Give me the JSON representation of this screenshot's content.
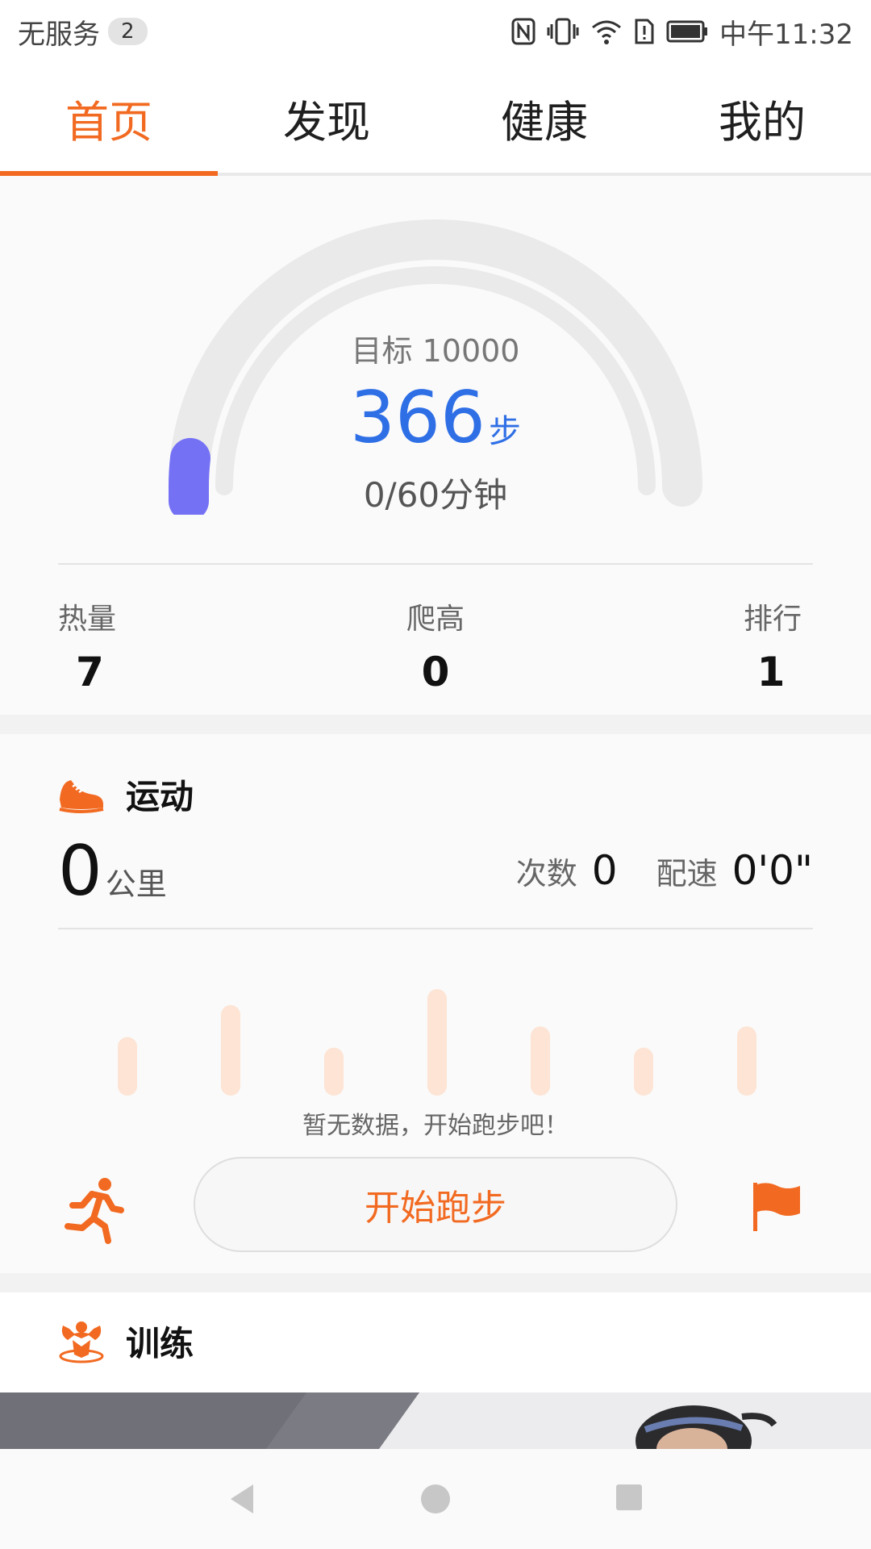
{
  "status_bar": {
    "carrier": "无服务",
    "sim_count": "2",
    "time": "中午11:32",
    "icons": [
      "nfc-icon",
      "vibrate-icon",
      "wifi-icon",
      "sim-alert-icon",
      "battery-icon"
    ]
  },
  "tabs": [
    {
      "label": "首页",
      "active": true
    },
    {
      "label": "发现",
      "active": false
    },
    {
      "label": "健康",
      "active": false
    },
    {
      "label": "我的",
      "active": false
    }
  ],
  "steps": {
    "goal_label": "目标 10000",
    "count": "366",
    "unit": "步",
    "minutes": "0/60分钟",
    "progress_fraction": 0.0366,
    "colors": {
      "progress": "#7571f5",
      "steps_text": "#2f6fe6",
      "track": "#eaeaea"
    }
  },
  "stats": [
    {
      "label": "热量",
      "value": "7"
    },
    {
      "label": "爬高",
      "value": "0"
    },
    {
      "label": "排行",
      "value": "1"
    }
  ],
  "exercise": {
    "title": "运动",
    "distance": "0",
    "distance_unit": "公里",
    "count_label": "次数",
    "count_value": "0",
    "pace_label": "配速",
    "pace_value": "0'0\"",
    "empty_text": "暂无数据，开始跑步吧！",
    "start_button": "开始跑步",
    "placeholder_bar_levels": [
      0.55,
      0.85,
      0.45,
      1.0,
      0.65,
      0.45,
      0.65
    ],
    "accent_color": "#f26a21"
  },
  "training": {
    "title": "训练"
  }
}
